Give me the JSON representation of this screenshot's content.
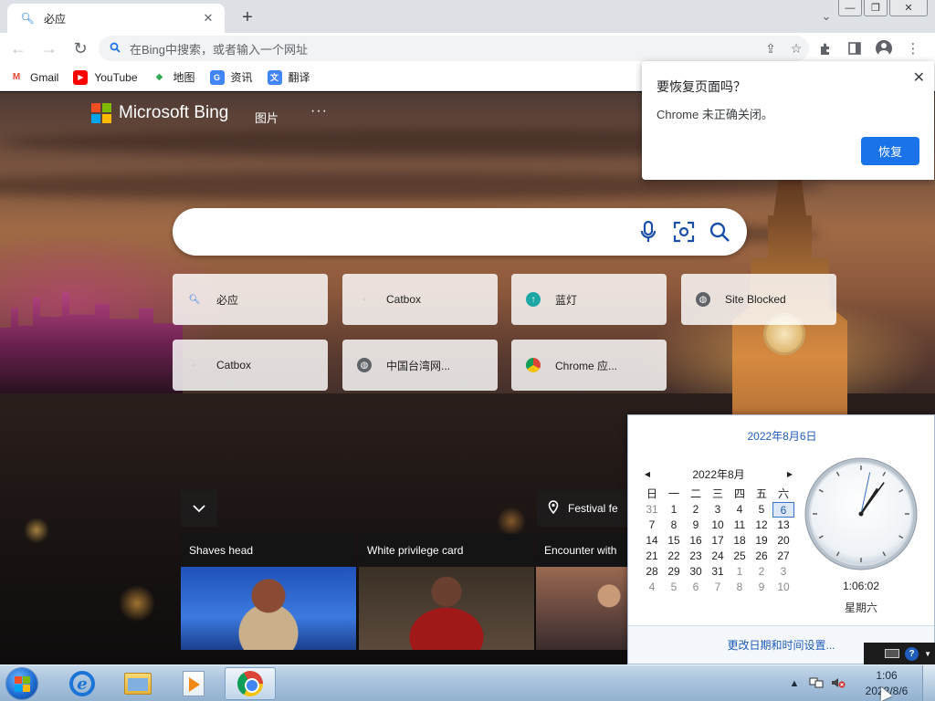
{
  "browser": {
    "tab": {
      "title": "必应",
      "close_label": "✕"
    },
    "new_tab_label": "+",
    "tab_search_label": "⌄",
    "window_buttons": {
      "minimize": "—",
      "restore": "❐",
      "close": "✕"
    },
    "nav": {
      "back": "←",
      "forward": "→",
      "reload": "↻"
    },
    "omnibox_placeholder": "在Bing中搜索，或者输入一个网址",
    "bookmarks": [
      {
        "label": "Gmail",
        "icon": "gmail-icon",
        "glyph": "M",
        "color": "#ea4335"
      },
      {
        "label": "YouTube",
        "icon": "youtube-icon",
        "glyph": "▶",
        "color": "#ff0000"
      },
      {
        "label": "地图",
        "icon": "maps-icon",
        "glyph": "◆",
        "color": "#34a853"
      },
      {
        "label": "资讯",
        "icon": "news-icon",
        "glyph": "G",
        "color": "#4285f4"
      },
      {
        "label": "翻译",
        "icon": "translate-icon",
        "glyph": "文",
        "color": "#4285f4"
      }
    ]
  },
  "bing": {
    "logo_text": "Microsoft Bing",
    "nav_images": "图片",
    "nav_more": "···",
    "tiles": [
      {
        "label": "必应",
        "icon": "search-icon"
      },
      {
        "label": "Catbox",
        "icon": "catbox-icon"
      },
      {
        "label": "蓝灯",
        "icon": "lantern-icon"
      },
      {
        "label": "Site Blocked",
        "icon": "globe-icon"
      },
      {
        "label": "Catbox",
        "icon": "catbox-icon"
      },
      {
        "label": "中国台湾网...",
        "icon": "globe-icon"
      },
      {
        "label": "Chrome 应...",
        "icon": "chrome-icon"
      }
    ],
    "festival_label": "Festival fe",
    "news_cards": [
      {
        "title": "Shaves head"
      },
      {
        "title": "White privilege card"
      },
      {
        "title": "Encounter with"
      }
    ]
  },
  "restore_popup": {
    "title": "要恢复页面吗？",
    "message": "Chrome 未正确关闭。",
    "button": "恢复",
    "close": "✕"
  },
  "calendar": {
    "header_date": "2022年8月6日",
    "month_label": "2022年8月",
    "prev": "◀",
    "next": "▶",
    "weekdays": [
      "日",
      "一",
      "二",
      "三",
      "四",
      "五",
      "六"
    ],
    "days": [
      [
        "31",
        "1",
        "2",
        "3",
        "4",
        "5",
        "6"
      ],
      [
        "7",
        "8",
        "9",
        "10",
        "11",
        "12",
        "13"
      ],
      [
        "14",
        "15",
        "16",
        "17",
        "18",
        "19",
        "20"
      ],
      [
        "21",
        "22",
        "23",
        "24",
        "25",
        "26",
        "27"
      ],
      [
        "28",
        "29",
        "30",
        "31",
        "1",
        "2",
        "3"
      ],
      [
        "4",
        "5",
        "6",
        "7",
        "8",
        "9",
        "10"
      ]
    ],
    "today": "6",
    "time": "1:06:02",
    "weekday": "星期六",
    "settings_link": "更改日期和时间设置..."
  },
  "taskbar": {
    "apps": [
      {
        "name": "internet-explorer"
      },
      {
        "name": "file-explorer"
      },
      {
        "name": "media-player"
      },
      {
        "name": "google-chrome"
      }
    ],
    "clock_time": "1:06",
    "clock_date": "2022/8/6"
  }
}
